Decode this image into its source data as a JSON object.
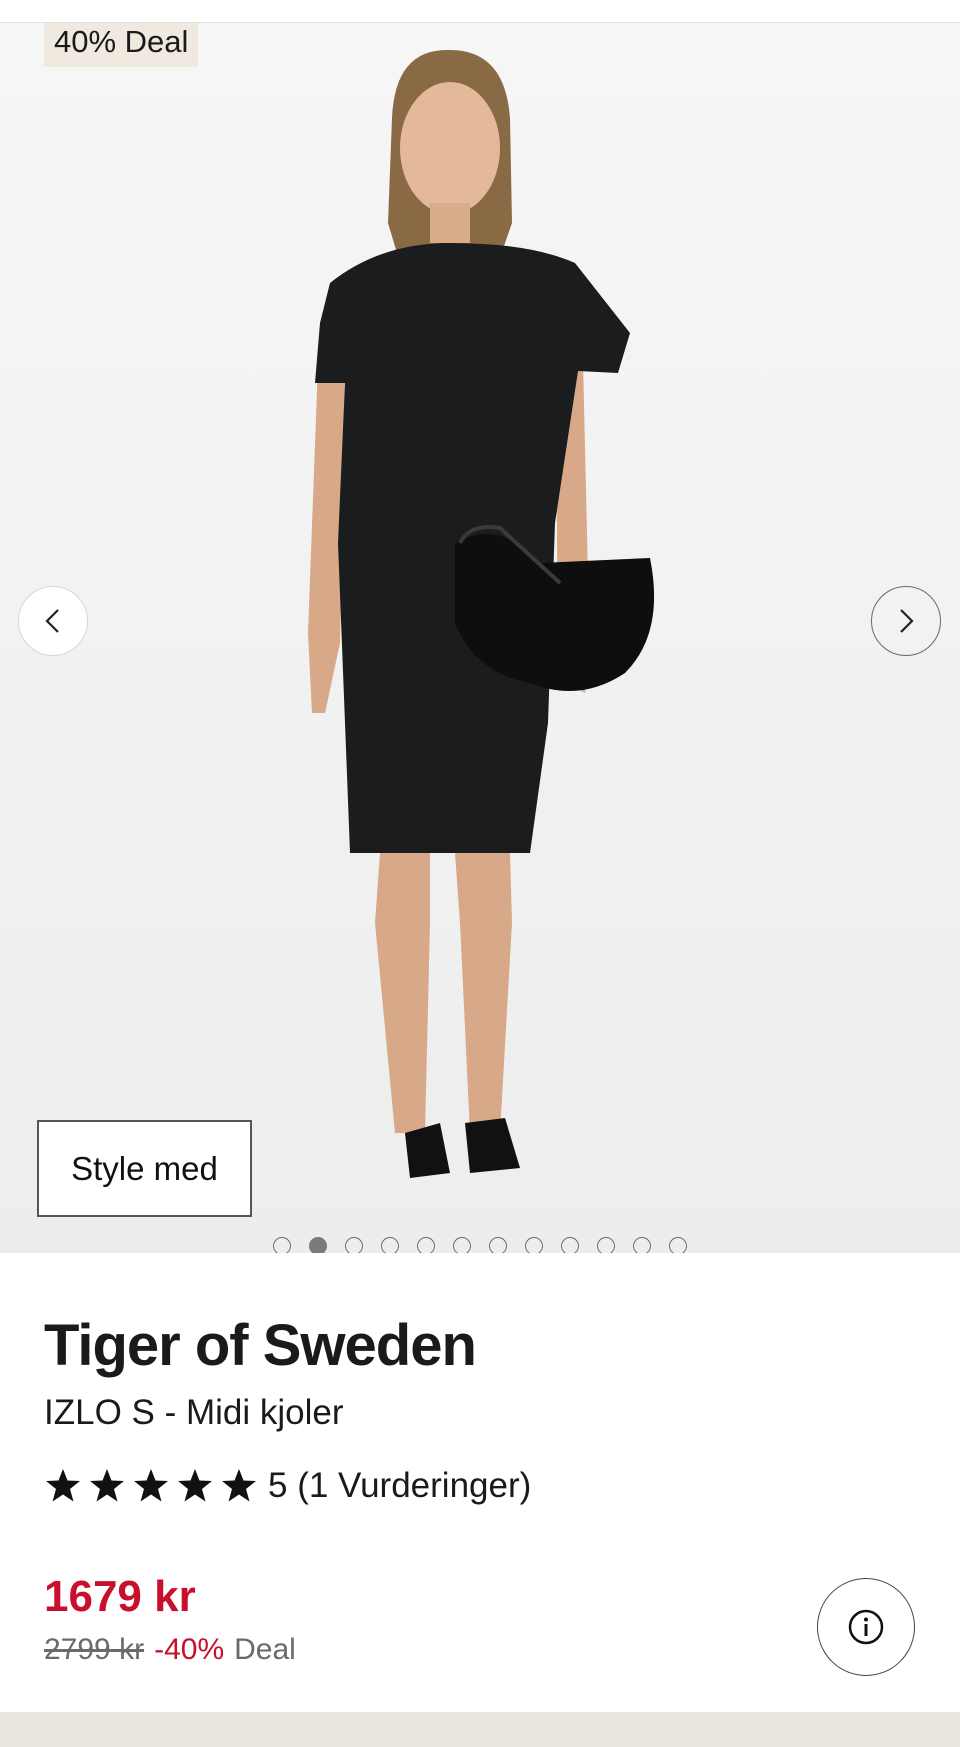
{
  "badge": {
    "label": "40% Deal"
  },
  "gallery": {
    "style_button": "Style med",
    "dot_count": 12,
    "active_index": 1
  },
  "product": {
    "brand": "Tiger of Sweden",
    "name": "IZLO S - Midi kjoler",
    "rating_stars": 5,
    "rating_text": "5 (1 Vurderinger)"
  },
  "price": {
    "current": "1679 kr",
    "original": "2799 kr",
    "discount": "-40%",
    "deal_label": "Deal"
  },
  "colors": {
    "accent_red": "#c8102e",
    "badge_bg": "#efe9e0",
    "image_bg": "#f3f3f3"
  },
  "icons": {
    "prev": "chevron-left-icon",
    "next": "chevron-right-icon",
    "info": "info-icon",
    "star": "star-icon"
  }
}
